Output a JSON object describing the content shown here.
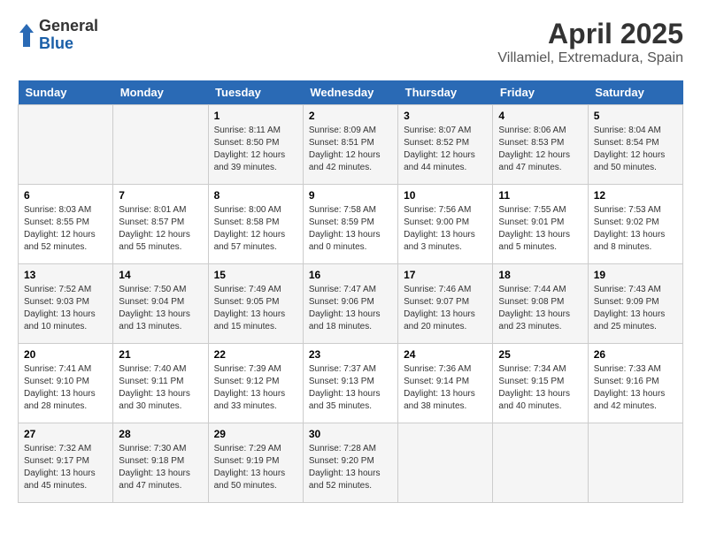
{
  "logo": {
    "general": "General",
    "blue": "Blue"
  },
  "title": "April 2025",
  "subtitle": "Villamiel, Extremadura, Spain",
  "days_header": [
    "Sunday",
    "Monday",
    "Tuesday",
    "Wednesday",
    "Thursday",
    "Friday",
    "Saturday"
  ],
  "weeks": [
    [
      {
        "day": "",
        "info": ""
      },
      {
        "day": "",
        "info": ""
      },
      {
        "day": "1",
        "info": "Sunrise: 8:11 AM\nSunset: 8:50 PM\nDaylight: 12 hours and 39 minutes."
      },
      {
        "day": "2",
        "info": "Sunrise: 8:09 AM\nSunset: 8:51 PM\nDaylight: 12 hours and 42 minutes."
      },
      {
        "day": "3",
        "info": "Sunrise: 8:07 AM\nSunset: 8:52 PM\nDaylight: 12 hours and 44 minutes."
      },
      {
        "day": "4",
        "info": "Sunrise: 8:06 AM\nSunset: 8:53 PM\nDaylight: 12 hours and 47 minutes."
      },
      {
        "day": "5",
        "info": "Sunrise: 8:04 AM\nSunset: 8:54 PM\nDaylight: 12 hours and 50 minutes."
      }
    ],
    [
      {
        "day": "6",
        "info": "Sunrise: 8:03 AM\nSunset: 8:55 PM\nDaylight: 12 hours and 52 minutes."
      },
      {
        "day": "7",
        "info": "Sunrise: 8:01 AM\nSunset: 8:57 PM\nDaylight: 12 hours and 55 minutes."
      },
      {
        "day": "8",
        "info": "Sunrise: 8:00 AM\nSunset: 8:58 PM\nDaylight: 12 hours and 57 minutes."
      },
      {
        "day": "9",
        "info": "Sunrise: 7:58 AM\nSunset: 8:59 PM\nDaylight: 13 hours and 0 minutes."
      },
      {
        "day": "10",
        "info": "Sunrise: 7:56 AM\nSunset: 9:00 PM\nDaylight: 13 hours and 3 minutes."
      },
      {
        "day": "11",
        "info": "Sunrise: 7:55 AM\nSunset: 9:01 PM\nDaylight: 13 hours and 5 minutes."
      },
      {
        "day": "12",
        "info": "Sunrise: 7:53 AM\nSunset: 9:02 PM\nDaylight: 13 hours and 8 minutes."
      }
    ],
    [
      {
        "day": "13",
        "info": "Sunrise: 7:52 AM\nSunset: 9:03 PM\nDaylight: 13 hours and 10 minutes."
      },
      {
        "day": "14",
        "info": "Sunrise: 7:50 AM\nSunset: 9:04 PM\nDaylight: 13 hours and 13 minutes."
      },
      {
        "day": "15",
        "info": "Sunrise: 7:49 AM\nSunset: 9:05 PM\nDaylight: 13 hours and 15 minutes."
      },
      {
        "day": "16",
        "info": "Sunrise: 7:47 AM\nSunset: 9:06 PM\nDaylight: 13 hours and 18 minutes."
      },
      {
        "day": "17",
        "info": "Sunrise: 7:46 AM\nSunset: 9:07 PM\nDaylight: 13 hours and 20 minutes."
      },
      {
        "day": "18",
        "info": "Sunrise: 7:44 AM\nSunset: 9:08 PM\nDaylight: 13 hours and 23 minutes."
      },
      {
        "day": "19",
        "info": "Sunrise: 7:43 AM\nSunset: 9:09 PM\nDaylight: 13 hours and 25 minutes."
      }
    ],
    [
      {
        "day": "20",
        "info": "Sunrise: 7:41 AM\nSunset: 9:10 PM\nDaylight: 13 hours and 28 minutes."
      },
      {
        "day": "21",
        "info": "Sunrise: 7:40 AM\nSunset: 9:11 PM\nDaylight: 13 hours and 30 minutes."
      },
      {
        "day": "22",
        "info": "Sunrise: 7:39 AM\nSunset: 9:12 PM\nDaylight: 13 hours and 33 minutes."
      },
      {
        "day": "23",
        "info": "Sunrise: 7:37 AM\nSunset: 9:13 PM\nDaylight: 13 hours and 35 minutes."
      },
      {
        "day": "24",
        "info": "Sunrise: 7:36 AM\nSunset: 9:14 PM\nDaylight: 13 hours and 38 minutes."
      },
      {
        "day": "25",
        "info": "Sunrise: 7:34 AM\nSunset: 9:15 PM\nDaylight: 13 hours and 40 minutes."
      },
      {
        "day": "26",
        "info": "Sunrise: 7:33 AM\nSunset: 9:16 PM\nDaylight: 13 hours and 42 minutes."
      }
    ],
    [
      {
        "day": "27",
        "info": "Sunrise: 7:32 AM\nSunset: 9:17 PM\nDaylight: 13 hours and 45 minutes."
      },
      {
        "day": "28",
        "info": "Sunrise: 7:30 AM\nSunset: 9:18 PM\nDaylight: 13 hours and 47 minutes."
      },
      {
        "day": "29",
        "info": "Sunrise: 7:29 AM\nSunset: 9:19 PM\nDaylight: 13 hours and 50 minutes."
      },
      {
        "day": "30",
        "info": "Sunrise: 7:28 AM\nSunset: 9:20 PM\nDaylight: 13 hours and 52 minutes."
      },
      {
        "day": "",
        "info": ""
      },
      {
        "day": "",
        "info": ""
      },
      {
        "day": "",
        "info": ""
      }
    ]
  ]
}
